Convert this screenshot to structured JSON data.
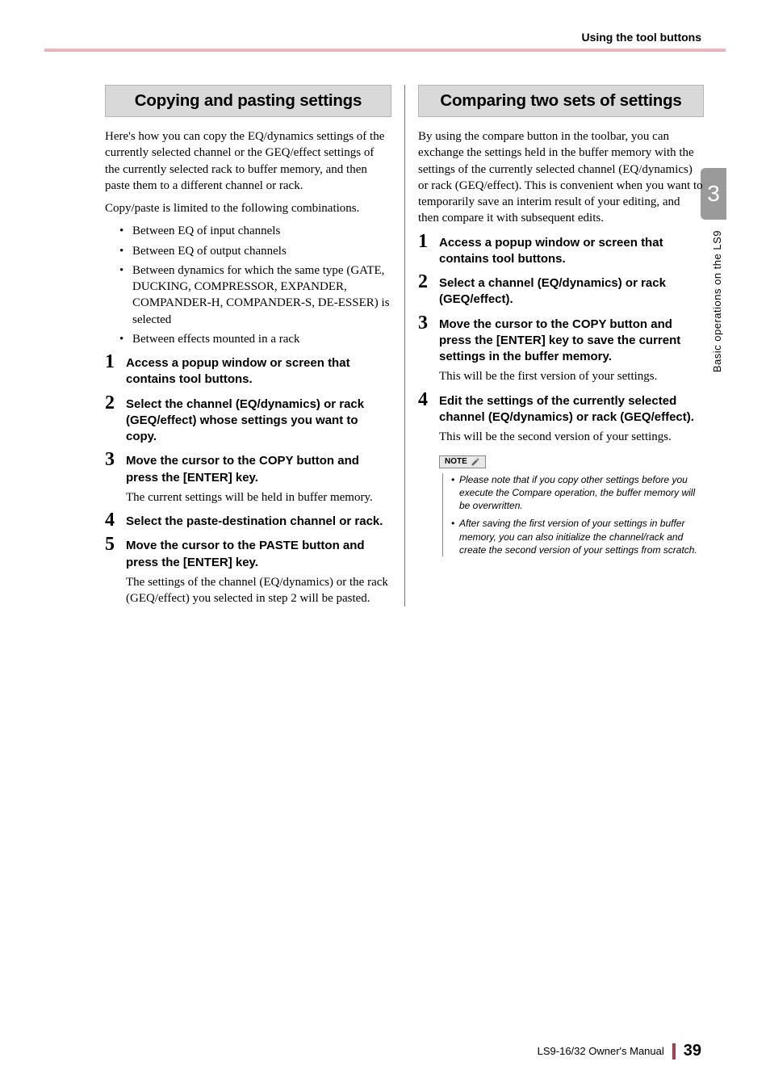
{
  "running_head": "Using the tool buttons",
  "side_tab": {
    "chapter_number": "3",
    "label": "Basic operations on the LS9"
  },
  "left_col": {
    "heading": "Copying and pasting settings",
    "intro1": "Here's how you can copy the EQ/dynamics settings of the currently selected channel or the GEQ/effect settings of the currently selected rack to buffer memory, and then paste them to a different channel or rack.",
    "intro2": "Copy/paste is limited to the following combinations.",
    "bullets": [
      "Between EQ of input channels",
      "Between EQ of output channels",
      "Between dynamics for which the same type (GATE, DUCKING, COMPRESSOR, EXPANDER, COMPANDER-H, COMPANDER-S, DE-ESSER) is selected",
      "Between effects mounted in a rack"
    ],
    "steps": [
      {
        "n": "1",
        "bold": "Access a popup window or screen that contains tool buttons."
      },
      {
        "n": "2",
        "bold": "Select the channel (EQ/dynamics) or rack (GEQ/effect) whose settings you want to copy."
      },
      {
        "n": "3",
        "bold": "Move the cursor to the COPY button and press the [ENTER] key.",
        "body": "The current settings will be held in buffer memory."
      },
      {
        "n": "4",
        "bold": "Select the paste-destination channel or rack."
      },
      {
        "n": "5",
        "bold": "Move the cursor to the PASTE button and press the [ENTER] key.",
        "body": "The settings of the channel (EQ/dynamics) or the rack (GEQ/effect) you selected in step 2 will be pasted."
      }
    ]
  },
  "right_col": {
    "heading": "Comparing two sets of settings",
    "intro1": "By using the compare button in the toolbar, you can exchange the settings held in the buffer memory with the settings of the currently selected channel (EQ/dynamics) or rack (GEQ/effect). This is convenient when you want to temporarily save an interim result of your editing, and then compare it with subsequent edits.",
    "steps": [
      {
        "n": "1",
        "bold": "Access a popup window or screen that contains tool buttons."
      },
      {
        "n": "2",
        "bold": "Select a channel (EQ/dynamics) or rack (GEQ/effect)."
      },
      {
        "n": "3",
        "bold": "Move the cursor to the COPY button and press the [ENTER] key to save the current settings in the buffer memory.",
        "body": "This will be the first version of your settings."
      },
      {
        "n": "4",
        "bold": "Edit the settings of the currently selected channel (EQ/dynamics) or rack (GEQ/effect).",
        "body": "This will be the second version of your settings."
      }
    ],
    "note_label": "NOTE",
    "notes": [
      "Please note that if you copy other settings before you execute the Compare operation, the buffer memory will be overwritten.",
      "After saving the first version of your settings in buffer memory, you can also initialize the channel/rack and create the second version of your settings from scratch."
    ]
  },
  "footer": {
    "doc": "LS9-16/32  Owner's Manual",
    "page": "39"
  }
}
